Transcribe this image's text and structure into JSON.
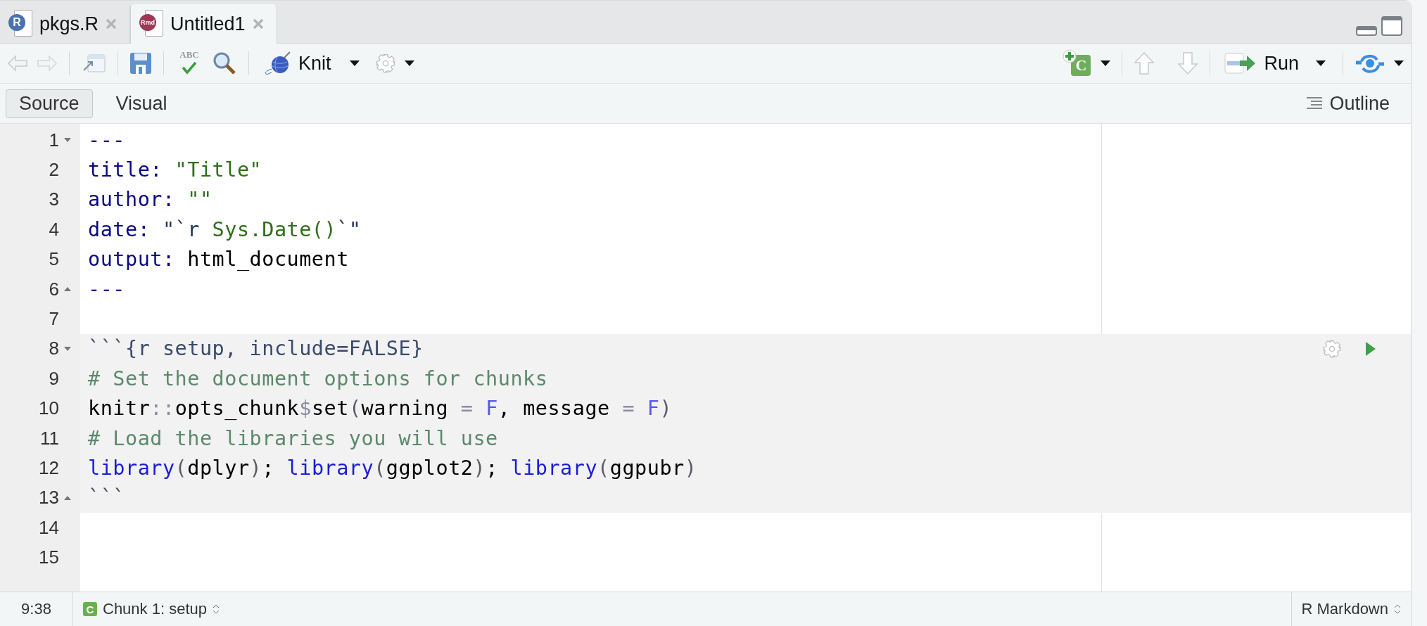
{
  "tabs": [
    {
      "label": "pkgs.R",
      "kind": "r",
      "badge": "R",
      "selected": false
    },
    {
      "label": "Untitled1",
      "kind": "rmd",
      "badge": "Rmd",
      "selected": true
    }
  ],
  "toolbar": {
    "spellcheck_badge": "ABC",
    "knit": "Knit",
    "insert_chunk_badge": "C",
    "run": "Run"
  },
  "modes": [
    {
      "label": "Source",
      "selected": true
    },
    {
      "label": "Visual",
      "selected": false
    }
  ],
  "outline": "Outline",
  "lines": [
    {
      "number": "1",
      "fold_start": true,
      "fold_end": false,
      "chunk": false,
      "tokens": [
        {
          "kind": "delimiter",
          "text": "---"
        }
      ]
    },
    {
      "number": "2",
      "fold_start": false,
      "fold_end": false,
      "chunk": false,
      "tokens": [
        {
          "kind": "key",
          "text": "title: "
        },
        {
          "kind": "string",
          "text": "\"Title\""
        }
      ]
    },
    {
      "number": "3",
      "fold_start": false,
      "fold_end": false,
      "chunk": false,
      "tokens": [
        {
          "kind": "key",
          "text": "author: "
        },
        {
          "kind": "string",
          "text": "\"\""
        }
      ]
    },
    {
      "number": "4",
      "fold_start": false,
      "fold_end": false,
      "chunk": false,
      "tokens": [
        {
          "kind": "key",
          "text": "date: "
        },
        {
          "kind": "inline",
          "text": "\"`r "
        },
        {
          "kind": "string",
          "text": "Sys.Date()"
        },
        {
          "kind": "inline",
          "text": "`\""
        }
      ]
    },
    {
      "number": "5",
      "fold_start": false,
      "fold_end": false,
      "chunk": false,
      "tokens": [
        {
          "kind": "key",
          "text": "output:"
        },
        {
          "kind": "plain",
          "text": " html_document"
        }
      ]
    },
    {
      "number": "6",
      "fold_start": false,
      "fold_end": true,
      "chunk": false,
      "tokens": [
        {
          "kind": "delimiter",
          "text": "---"
        }
      ]
    },
    {
      "number": "7",
      "fold_start": false,
      "fold_end": false,
      "chunk": false
    },
    {
      "number": "8",
      "fold_start": true,
      "fold_end": false,
      "chunk": true,
      "controls": true,
      "tokens": [
        {
          "kind": "header",
          "text": "```{r setup, include=FALSE}"
        }
      ]
    },
    {
      "number": "9",
      "fold_start": false,
      "fold_end": false,
      "chunk": true,
      "tokens": [
        {
          "kind": "comment",
          "text": "# Set the document options for chunks"
        }
      ]
    },
    {
      "number": "10",
      "fold_start": false,
      "fold_end": false,
      "chunk": true,
      "tokens": [
        {
          "kind": "plain",
          "text": "knitr"
        },
        {
          "kind": "operator",
          "text": "::"
        },
        {
          "kind": "plain",
          "text": "opts_chunk"
        },
        {
          "kind": "operator",
          "text": "$"
        },
        {
          "kind": "plain",
          "text": "set"
        },
        {
          "kind": "paren",
          "text": "("
        },
        {
          "kind": "plain",
          "text": "warning "
        },
        {
          "kind": "operator",
          "text": "= "
        },
        {
          "kind": "constant",
          "text": "F"
        },
        {
          "kind": "plain",
          "text": ", message "
        },
        {
          "kind": "operator",
          "text": "= "
        },
        {
          "kind": "constant",
          "text": "F"
        },
        {
          "kind": "paren",
          "text": ")"
        }
      ]
    },
    {
      "number": "11",
      "fold_start": false,
      "fold_end": false,
      "chunk": true,
      "tokens": [
        {
          "kind": "comment",
          "text": "# Load the libraries you will use"
        }
      ]
    },
    {
      "number": "12",
      "fold_start": false,
      "fold_end": false,
      "chunk": true,
      "tokens": [
        {
          "kind": "function",
          "text": "library"
        },
        {
          "kind": "paren",
          "text": "("
        },
        {
          "kind": "plain",
          "text": "dplyr"
        },
        {
          "kind": "paren",
          "text": ")"
        },
        {
          "kind": "plain",
          "text": "; "
        },
        {
          "kind": "function",
          "text": "library"
        },
        {
          "kind": "paren",
          "text": "("
        },
        {
          "kind": "plain",
          "text": "ggplot2"
        },
        {
          "kind": "paren",
          "text": ")"
        },
        {
          "kind": "plain",
          "text": "; "
        },
        {
          "kind": "function",
          "text": "library"
        },
        {
          "kind": "paren",
          "text": "("
        },
        {
          "kind": "plain",
          "text": "ggpubr"
        },
        {
          "kind": "paren",
          "text": ")"
        }
      ]
    },
    {
      "number": "13",
      "fold_start": false,
      "fold_end": true,
      "chunk": true,
      "tokens": [
        {
          "kind": "header",
          "text": "```"
        }
      ]
    },
    {
      "number": "14",
      "fold_start": false,
      "fold_end": false,
      "chunk": false
    },
    {
      "number": "15",
      "fold_start": false,
      "fold_end": false,
      "chunk": false
    }
  ],
  "status_bar": {
    "position": "9:38",
    "chunk_badge": "C",
    "chunk": "Chunk 1: setup",
    "file_type": "R Markdown"
  }
}
